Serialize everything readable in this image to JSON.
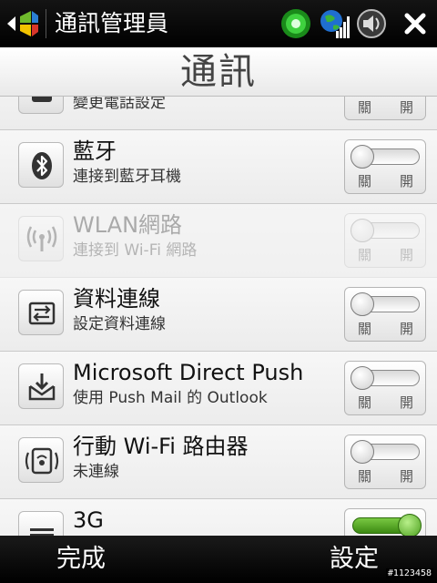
{
  "status_bar": {
    "app_title": "通訊管理員",
    "icons": [
      "windows-start-icon",
      "connectivity-icon",
      "signal-strength-icon",
      "volume-icon",
      "close-icon"
    ]
  },
  "header": {
    "title": "通訊"
  },
  "toggle_labels": {
    "off": "關",
    "on": "開"
  },
  "rows": [
    {
      "icon": "phone-settings-icon",
      "title": "",
      "subtitle": "變更電話設定",
      "state": "off",
      "enabled": true
    },
    {
      "icon": "bluetooth-icon",
      "title": "藍牙",
      "subtitle": "連接到藍牙耳機",
      "state": "off",
      "enabled": true
    },
    {
      "icon": "wlan-antenna-icon",
      "title": "WLAN網路",
      "subtitle": "連接到 Wi-Fi 網路",
      "state": "off",
      "enabled": false
    },
    {
      "icon": "data-connection-icon",
      "title": "資料連線",
      "subtitle": "設定資料連線",
      "state": "off",
      "enabled": true
    },
    {
      "icon": "direct-push-icon",
      "title": "Microsoft Direct Push",
      "subtitle": "使用 Push Mail 的 Outlook",
      "state": "off",
      "enabled": true
    },
    {
      "icon": "wifi-router-icon",
      "title": "行動 Wi-Fi 路由器",
      "subtitle": "未連線",
      "state": "off",
      "enabled": true
    },
    {
      "icon": "3g-icon",
      "title": "3G",
      "subtitle": "",
      "state": "on",
      "enabled": true
    }
  ],
  "softkeys": {
    "left": "完成",
    "right": "設定"
  },
  "watermark": "#1123458",
  "colors": {
    "toggle_on": "#4a9f1c",
    "toolbar_bg": "#000000",
    "list_bg": "#f3f3f3"
  }
}
